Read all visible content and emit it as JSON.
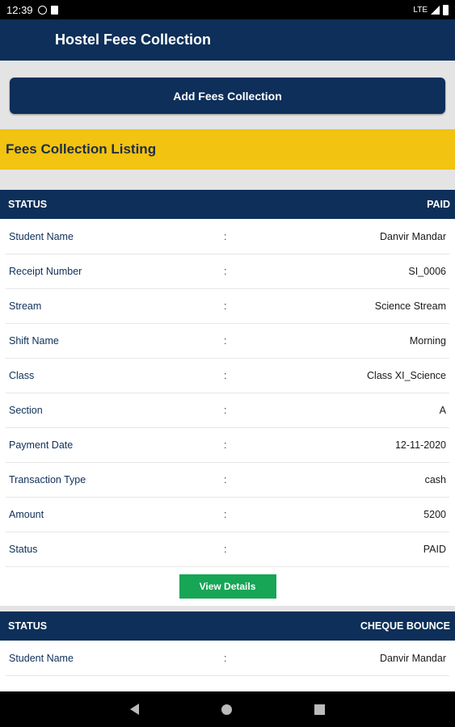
{
  "status_bar": {
    "time": "12:39",
    "network": "LTE"
  },
  "app_bar": {
    "title": "Hostel Fees Collection"
  },
  "actions": {
    "add_label": "Add Fees Collection"
  },
  "listing": {
    "title": "Fees Collection Listing"
  },
  "records": [
    {
      "status_label": "STATUS",
      "status_value": "PAID",
      "fields": [
        {
          "label": "Student Name",
          "sep": ":",
          "value": "Danvir Mandar"
        },
        {
          "label": "Receipt Number",
          "sep": ":",
          "value": "SI_0006"
        },
        {
          "label": "Stream",
          "sep": ":",
          "value": "Science Stream"
        },
        {
          "label": "Shift Name",
          "sep": ":",
          "value": "Morning"
        },
        {
          "label": "Class",
          "sep": ":",
          "value": "Class XI_Science"
        },
        {
          "label": "Section",
          "sep": ":",
          "value": "A"
        },
        {
          "label": "Payment Date",
          "sep": ":",
          "value": "12-11-2020"
        },
        {
          "label": "Transaction Type",
          "sep": ":",
          "value": "cash"
        },
        {
          "label": "Amount",
          "sep": ":",
          "value": "5200"
        },
        {
          "label": "Status",
          "sep": ":",
          "value": "PAID"
        }
      ],
      "view_label": "View Details"
    },
    {
      "status_label": "STATUS",
      "status_value": "CHEQUE BOUNCE",
      "fields": [
        {
          "label": "Student Name",
          "sep": ":",
          "value": "Danvir Mandar"
        }
      ]
    }
  ],
  "icons": {
    "status_bar": [
      "sync-icon",
      "sd-card-icon",
      "signal-icon",
      "battery-icon"
    ],
    "nav_bar": [
      "back-icon",
      "home-icon",
      "recents-icon"
    ]
  },
  "colors": {
    "primary": "#0d2f59",
    "accent": "#f2c310",
    "success": "#17a556"
  }
}
